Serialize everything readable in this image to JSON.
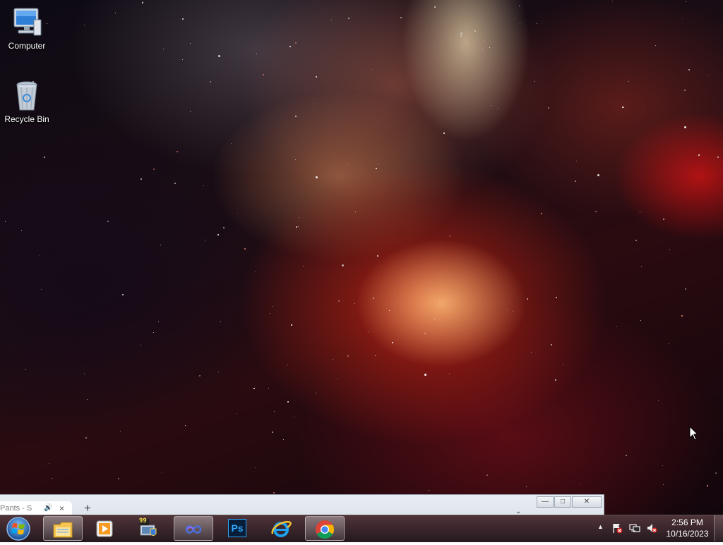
{
  "desktop": {
    "icons": [
      {
        "label": "Computer"
      },
      {
        "label": "Recycle Bin"
      }
    ]
  },
  "window": {
    "tab_title": "Pants - S",
    "new_tab_symbol": "+",
    "tab_menu_symbol": "⌄",
    "minimize_symbol": "—",
    "maximize_symbol": "□",
    "close_symbol": "✕",
    "tab_close_symbol": "×"
  },
  "taskbar": {
    "pinned": [
      {
        "name": "windows-explorer",
        "icon": "folder-icon"
      },
      {
        "name": "media-player",
        "icon": "media-player-icon"
      },
      {
        "name": "security-app",
        "icon": "shield-monitor-icon",
        "badge": "99"
      },
      {
        "name": "infinity-app",
        "icon": "infinity-icon"
      },
      {
        "name": "photoshop",
        "icon": "photoshop-icon",
        "label": "Ps"
      },
      {
        "name": "internet-explorer",
        "icon": "ie-icon"
      },
      {
        "name": "chrome",
        "icon": "chrome-icon"
      }
    ],
    "tray": {
      "show_hidden_symbol": "▲",
      "icons": [
        "action-center-flag-icon",
        "network-icon",
        "volume-muted-icon"
      ]
    },
    "clock": {
      "time": "2:56 PM",
      "date": "10/16/2023"
    }
  }
}
